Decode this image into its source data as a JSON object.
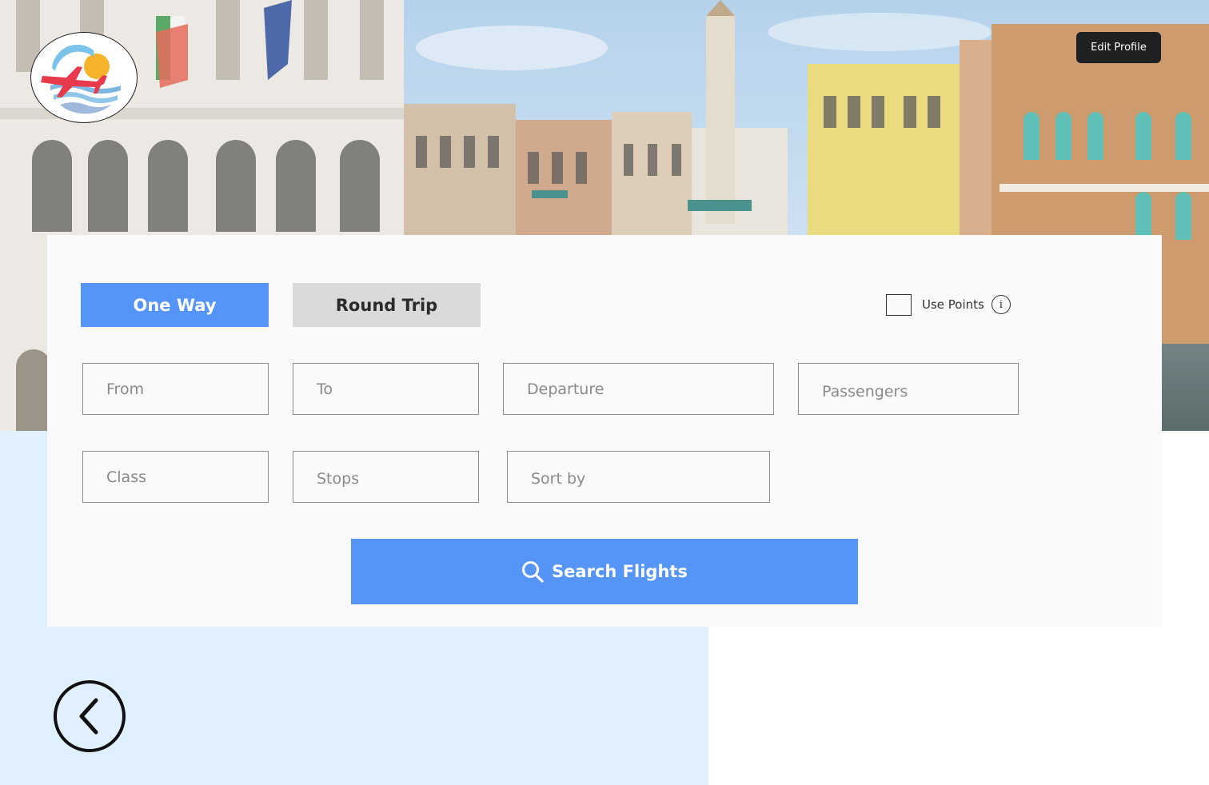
{
  "header": {
    "logo_icon": "airline-logo-plane-sun-icon",
    "edit_profile_label": "Edit Profile"
  },
  "search": {
    "trip_types": {
      "one_way": "One Way",
      "round_trip": "Round Trip",
      "selected": "One Way"
    },
    "use_points": {
      "label": "Use Points",
      "checked": false,
      "info_icon": "info-icon",
      "info_glyph": "i"
    },
    "fields": {
      "from": "From",
      "to": "To",
      "departure": "Departure",
      "passengers": "Passengers",
      "class": "Class",
      "stops": "Stops",
      "sort_by": "Sort by"
    },
    "submit": {
      "label": "Search Flights",
      "icon": "search-icon"
    }
  },
  "navigation": {
    "back_icon": "chevron-left-circle-icon"
  },
  "colors": {
    "accent": "#5595f7",
    "inactive_tab": "#dadada",
    "panel": "#fafafa",
    "light_band": "#e1f0fe",
    "dark_button": "#1f2021"
  }
}
